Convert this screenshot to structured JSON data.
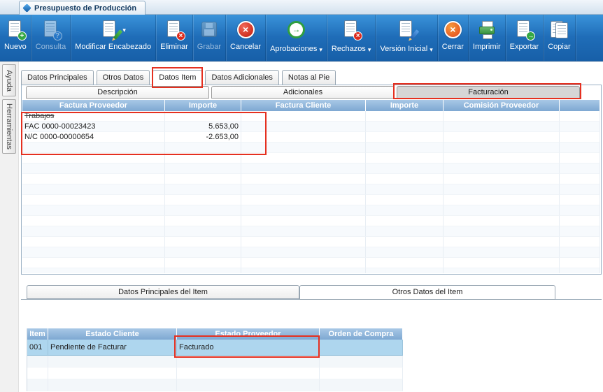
{
  "window": {
    "title": "Presupuesto de Producción"
  },
  "toolbar": {
    "buttons": [
      {
        "label": "Nuevo",
        "icon": "new-document-icon",
        "enabled": true,
        "dropdown": false
      },
      {
        "label": "Consulta",
        "icon": "query-document-icon",
        "enabled": false,
        "dropdown": false
      },
      {
        "label": "Modificar Encabezado",
        "icon": "edit-header-icon",
        "enabled": true,
        "dropdown": true
      },
      {
        "label": "Eliminar",
        "icon": "delete-document-icon",
        "enabled": true,
        "dropdown": false
      },
      {
        "label": "Grabar",
        "icon": "save-disk-icon",
        "enabled": false,
        "dropdown": false
      },
      {
        "label": "Cancelar",
        "icon": "cancel-circle-icon",
        "enabled": true,
        "dropdown": false
      },
      {
        "label": "Aprobaciones",
        "icon": "approve-circle-icon",
        "enabled": true,
        "dropdown": true
      },
      {
        "label": "Rechazos",
        "icon": "reject-document-icon",
        "enabled": true,
        "dropdown": true
      },
      {
        "label": "Versión Inicial",
        "icon": "initial-version-icon",
        "enabled": true,
        "dropdown": true
      },
      {
        "label": "Cerrar",
        "icon": "close-circle-icon",
        "enabled": true,
        "dropdown": false
      },
      {
        "label": "Imprimir",
        "icon": "printer-icon",
        "enabled": true,
        "dropdown": false
      },
      {
        "label": "Exportar",
        "icon": "export-document-icon",
        "enabled": true,
        "dropdown": false
      },
      {
        "label": "Copiar",
        "icon": "copy-documents-icon",
        "enabled": true,
        "dropdown": false
      }
    ]
  },
  "sidebar": {
    "tabs": [
      "Ayuda",
      "Herramientas"
    ]
  },
  "main_tabs": [
    {
      "label": "Datos Principales",
      "active": false
    },
    {
      "label": "Otros Datos",
      "active": false
    },
    {
      "label": "Datos Item",
      "active": true,
      "annotated": true
    },
    {
      "label": "Datos Adicionales",
      "active": false
    },
    {
      "label": "Notas al Pie",
      "active": false
    }
  ],
  "sub_tabs": [
    {
      "label": "Descripción",
      "active": false
    },
    {
      "label": "Adicionales",
      "active": false
    },
    {
      "label": "Facturación",
      "active": true,
      "annotated": true
    }
  ],
  "invoice_table": {
    "columns": [
      "Factura Proveedor",
      "Importe",
      "Factura Cliente",
      "Importe",
      "Comisión Proveedor"
    ],
    "group_row": "Trabajos",
    "rows": [
      {
        "factura_proveedor": "FAC 0000-00023423",
        "importe": "5.653,00"
      },
      {
        "factura_proveedor": "N/C 0000-00000654",
        "importe": "-2.653,00"
      }
    ]
  },
  "item_tabs": [
    {
      "label": "Datos Principales del Item",
      "active": false
    },
    {
      "label": "Otros Datos del Item",
      "active": true
    }
  ],
  "item_table": {
    "columns": [
      "Item",
      "Estado Cliente",
      "Estado Proveedor",
      "Orden de Compra"
    ],
    "rows": [
      {
        "item": "001",
        "estado_cliente": "Pendiente de Facturar",
        "estado_proveedor": "Facturado",
        "orden_compra": ""
      }
    ]
  },
  "colors": {
    "toolbar_blue": "#1f6db8",
    "grid_header_blue": "#8db3d8",
    "selected_row_blue": "#aed6ee",
    "subtab_active_gray": "#d6d6d6",
    "annotation_red": "#e53020"
  }
}
